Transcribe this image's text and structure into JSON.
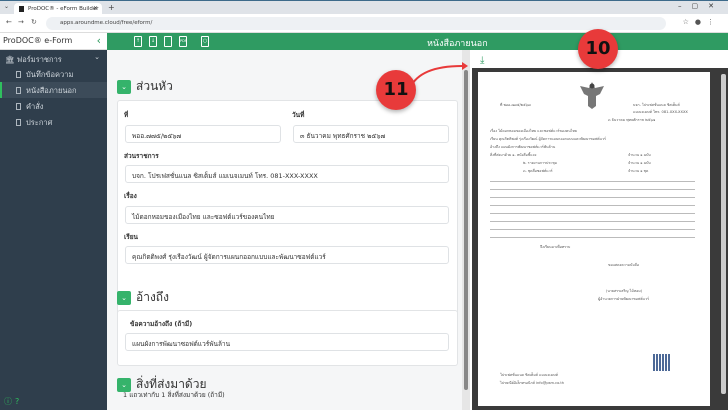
{
  "browser": {
    "tab_title": "ProDOC® - eForm Builder",
    "url": "apps.aroundme.cloud/free/eform/"
  },
  "sidebar": {
    "app_title": "ProDOC® e-Form",
    "group": "ฟอร์มราชการ",
    "items": [
      {
        "label": "บันทึกข้อความ",
        "active": false
      },
      {
        "label": "หนังสือภายนอก",
        "active": true
      },
      {
        "label": "คำสั่ง",
        "active": false
      },
      {
        "label": "ประกาศ",
        "active": false
      }
    ]
  },
  "toolbar": {
    "title": "หนังสือภายนอก",
    "pdf_label": "PDF"
  },
  "form": {
    "header_section": "ส่วนหัว",
    "number_label": "ที่",
    "number_value": "พออ.๗๗๕/๒๕๖๗",
    "date_label": "วันที่",
    "date_value": "๓ ธันวาคม พุทธศักราช ๒๕๖๗",
    "agency_label": "ส่วนราชการ",
    "agency_value": "บจก. โปรเฟสชั่นแนล ซิสเต็มส์ แมเนจเมนท์ โทร. 081-XXX-XXXX",
    "subject_label": "เรื่อง",
    "subject_value": "ไม้ดอกหอมของเมืองไทย และซอฟต์แวร์ของคนไทย",
    "to_label": "เรียน",
    "to_value": "คุณกิตติพงศ์ รุ่งเรืองวัฒน์ ผู้จัดการแผนกออกแบบและพัฒนาซอฟต์แวร์",
    "ref_section": "อ้างถึง",
    "ref_label": "ข้อความอ้างถึง (ถ้ามี)",
    "ref_value": "แผนผังการพัฒนาซอฟต์แวร์พันล้าน",
    "enclosure_section": "สิ่งที่ส่งมาด้วย",
    "enclosure_hint": "1 แถวเท่ากับ 1 สิ่งที่ส่งมาด้วย (ถ้ามี)"
  },
  "preview": {
    "number": "ที่ พออ.๗๗๕/๒๕๖๗",
    "org1": "บจก. โปรเฟสชั่นแนล ซิสเต็มส์",
    "org2": "แมเนจเมนท์ โทร. 081-XXX-XXXX",
    "date": "๓ ธันวาคม พุทธศักราช ๒๕๖๗",
    "subject": "เรื่อง   ไม้ดอกหอมของเมืองไทย และซอฟต์แวร์ของคนไทย",
    "to": "เรียน   คุณกิตติพงศ์ รุ่งเรืองวัฒน์ ผู้จัดการแผนกออกแบบและพัฒนาซอฟต์แวร์",
    "ref": "อ้างถึง   แผนผังการพัฒนาซอฟต์แวร์พันล้าน",
    "enclosures": [
      {
        "item": "สิ่งที่ส่งมาด้วย   ๑. หนังสือชี้แจง",
        "qty": "จำนวน ๑ ฉบับ"
      },
      {
        "item": "๒. รายงานการประชุม",
        "qty": "จำนวน ๑ ฉบับ"
      },
      {
        "item": "๓. ชุดสื่อซอฟต์แวร์",
        "qty": "จำนวน ๑ ชุด"
      }
    ],
    "closing": "จึงเรียนมาเพื่อทราบ",
    "regards": "ขอแสดงความนับถือ",
    "signer": "(นายสรรเสริญ ไม้หอม)",
    "position": "ผู้อำนวยการฝ่ายพัฒนาซอฟต์แวร์",
    "footer1": "โปรเฟสชั่นแนล ซิสเต็มส์ แมเนจเมนท์",
    "footer2": "ไปรษณีย์อิเล็กทรอนิกส์ info@psm.co.th"
  },
  "annotations": {
    "badge_10": "10",
    "badge_11": "11"
  },
  "colors": {
    "brand_green": "#2f9b62",
    "sidebar_bg": "#2f3e4c",
    "badge_red": "#e83a3a"
  }
}
